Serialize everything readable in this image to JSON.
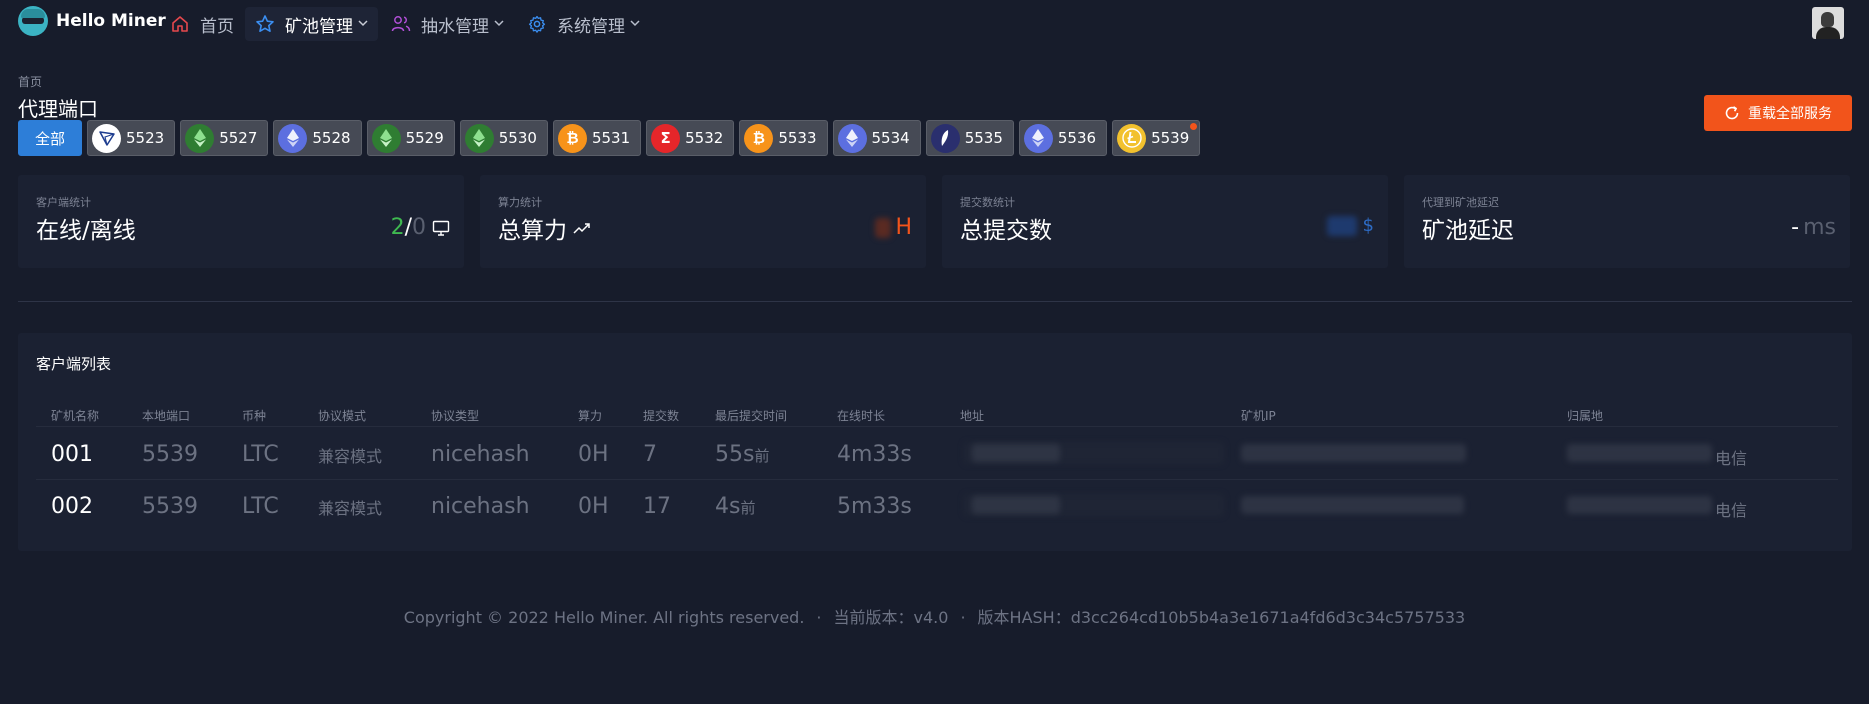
{
  "brand": {
    "name": "Hello Miner"
  },
  "nav": {
    "home": "首页",
    "pool": "矿池管理",
    "pump": "抽水管理",
    "system": "系统管理"
  },
  "breadcrumb": "首页",
  "page_title": "代理端口",
  "reload_button": "重载全部服务",
  "port_tabs": {
    "all": "全部",
    "ports": [
      {
        "port": "5523",
        "coin": "tron-icon"
      },
      {
        "port": "5527",
        "coin": "etc-icon"
      },
      {
        "port": "5528",
        "coin": "eth-icon"
      },
      {
        "port": "5529",
        "coin": "etc-icon"
      },
      {
        "port": "5530",
        "coin": "etc-icon"
      },
      {
        "port": "5531",
        "coin": "btc-icon"
      },
      {
        "port": "5532",
        "coin": "sigma-icon"
      },
      {
        "port": "5533",
        "coin": "btc-icon"
      },
      {
        "port": "5534",
        "coin": "eth-icon"
      },
      {
        "port": "5535",
        "coin": "feather-icon"
      },
      {
        "port": "5536",
        "coin": "eth-icon"
      },
      {
        "port": "5539",
        "coin": "ltc-icon"
      }
    ]
  },
  "stats": {
    "online": {
      "caption": "客户端统计",
      "label": "在线/离线",
      "online_count": "2",
      "slash": "/",
      "offline_count": "0"
    },
    "hashrate": {
      "caption": "算力统计",
      "label": "总算力",
      "unit": "H"
    },
    "shares": {
      "caption": "提交数统计",
      "label": "总提交数",
      "unit": "$"
    },
    "latency": {
      "caption": "代理到矿池延迟",
      "label": "矿池延迟",
      "value": "-",
      "unit": "ms"
    }
  },
  "client_list": {
    "title": "客户端列表",
    "columns": [
      "矿机名称",
      "本地端口",
      "币种",
      "协议模式",
      "协议类型",
      "算力",
      "提交数",
      "最后提交时间",
      "在线时长",
      "地址",
      "矿机IP",
      "归属地"
    ],
    "rows": [
      {
        "name": "001",
        "port": "5539",
        "coin": "LTC",
        "mode": "兼容模式",
        "protocol": "nicehash",
        "hashrate": "0H",
        "shares": "7",
        "last_num": "55s",
        "last_suffix": "前",
        "uptime": "4m33s",
        "isp": "电信"
      },
      {
        "name": "002",
        "port": "5539",
        "coin": "LTC",
        "mode": "兼容模式",
        "protocol": "nicehash",
        "hashrate": "0H",
        "shares": "17",
        "last_num": "4s",
        "last_suffix": "前",
        "uptime": "5m33s",
        "isp": "电信"
      }
    ]
  },
  "footer": {
    "copyright": "Copyright © 2022 Hello Miner. All rights reserved.",
    "sep1": "·",
    "version": "当前版本：v4.0",
    "sep2": "·",
    "hash": "版本HASH：d3cc264cd10b5b4a3e1671a4fd6d3c34c5757533"
  },
  "colors": {
    "accent": "#2d7ed8",
    "danger": "#f2541b",
    "online": "#3fb950",
    "hashrate": "#f2541b",
    "shares": "#2d7ed8"
  }
}
